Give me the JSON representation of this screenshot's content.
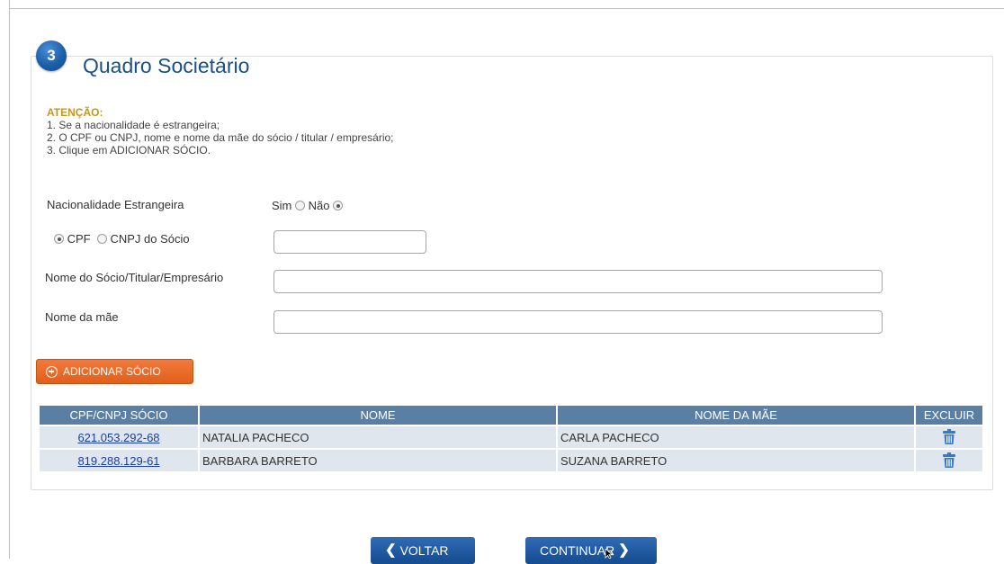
{
  "section": {
    "step_number": "3",
    "title": "Quadro Societário"
  },
  "attention": {
    "title": "ATENÇÃO:",
    "lines": [
      "1. Se a nacionalidade é estrangeira;",
      "2. O CPF ou CNPJ, nome e nome da mãe do sócio / titular / empresário;",
      "3. Clique em ADICIONAR SÓCIO."
    ]
  },
  "form": {
    "nacionalidade_label": "Nacionalidade Estrangeira",
    "sim_label": "Sim",
    "nao_label": "Não",
    "nacionalidade_selected": "Não",
    "cpf_label": "CPF",
    "cnpj_label": "CNPJ do Sócio",
    "doc_selected": "CPF",
    "doc_value": "",
    "nome_label": "Nome do Sócio/Titular/Empresário",
    "nome_value": "",
    "mae_label": "Nome da mãe",
    "mae_value": ""
  },
  "add_button": {
    "label": "ADICIONAR SÓCIO",
    "icon": "plus-circle-icon"
  },
  "table": {
    "headers": [
      "CPF/CNPJ SÓCIO",
      "NOME",
      "NOME DA MÃE",
      "EXCLUIR"
    ],
    "rows": [
      {
        "cpf": "621.053.292-68",
        "nome": "NATALIA PACHECO",
        "mae": "CARLA PACHECO"
      },
      {
        "cpf": "819.288.129-61",
        "nome": "BARBARA BARRETO",
        "mae": "SUZANA BARRETO"
      }
    ]
  },
  "nav": {
    "voltar": "VOLTAR",
    "continuar": "CONTINUAR"
  },
  "colors": {
    "title_blue": "#1b4f8a",
    "attention_gold": "#c8951b",
    "add_orange": "#e15f1c",
    "table_header": "#5b7fa3",
    "table_row": "#e0e6ee",
    "nav_blue": "#1a56a0"
  }
}
